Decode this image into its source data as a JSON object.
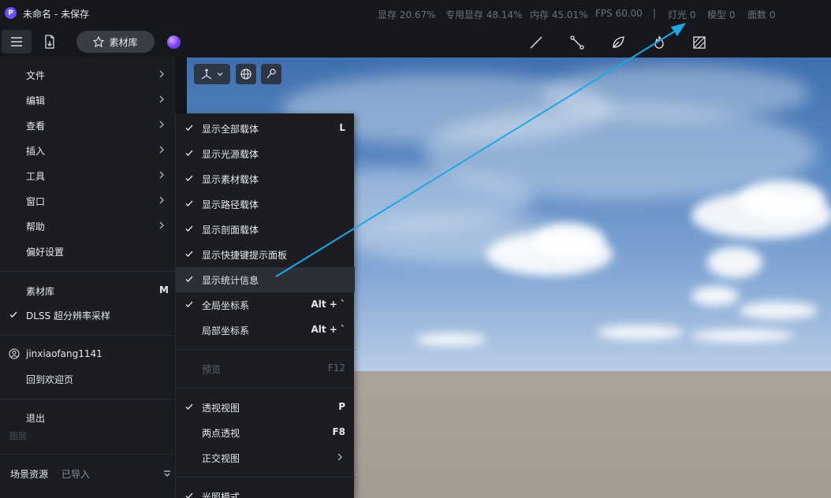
{
  "window": {
    "logo_letter": "P",
    "title": "未命名 - 未保存"
  },
  "stats": {
    "vram": "显存 20.67%",
    "dedicated_vram": "专用显存 48.14%",
    "memory": "内存 45.01%",
    "fps": "FPS 60.00",
    "divider": "|",
    "lights": "灯光 0",
    "models": "模型 0",
    "faces": "面数 0"
  },
  "toolbar": {
    "library_label": "素材库"
  },
  "main_menu": {
    "items": [
      {
        "label": "文件"
      },
      {
        "label": "编辑"
      },
      {
        "label": "查看"
      },
      {
        "label": "插入"
      },
      {
        "label": "工具"
      },
      {
        "label": "窗口"
      },
      {
        "label": "帮助"
      },
      {
        "label": "偏好设置"
      }
    ],
    "library": {
      "label": "素材库",
      "key": "M"
    },
    "dlss": {
      "label": "DLSS 超分辨率采样"
    },
    "user": {
      "label": "jinxiaofang1141"
    },
    "welcome": {
      "label": "回到欢迎页"
    },
    "exit": {
      "label": "退出"
    }
  },
  "sidebar_behind": {
    "layers_label": "图层",
    "scene_assets_label": "场景资源",
    "imported_label": "已导入"
  },
  "view_submenu": {
    "items": [
      {
        "label": "显示全部载体",
        "key": "L"
      },
      {
        "label": "显示光源载体",
        "key": ""
      },
      {
        "label": "显示素材载体",
        "key": ""
      },
      {
        "label": "显示路径载体",
        "key": ""
      },
      {
        "label": "显示剖面载体",
        "key": ""
      },
      {
        "label": "显示快捷键提示面板",
        "key": ""
      },
      {
        "label": "显示统计信息",
        "key": ""
      },
      {
        "label": "全局坐标系",
        "key": "Alt + `"
      },
      {
        "label": "局部坐标系",
        "key": "Alt + `"
      }
    ],
    "preview": {
      "label": "预览",
      "key": "F12"
    },
    "perspective": {
      "label": "透视视图",
      "key": "P"
    },
    "two_point": {
      "label": "两点透视",
      "key": "F8"
    },
    "ortho": {
      "label": "正交视图"
    },
    "lighting": {
      "label": "光照模式"
    }
  },
  "colors": {
    "accent": "#1fa7e0",
    "menu_bg": "#1b1d23",
    "hover_bg": "#2c2f37"
  }
}
